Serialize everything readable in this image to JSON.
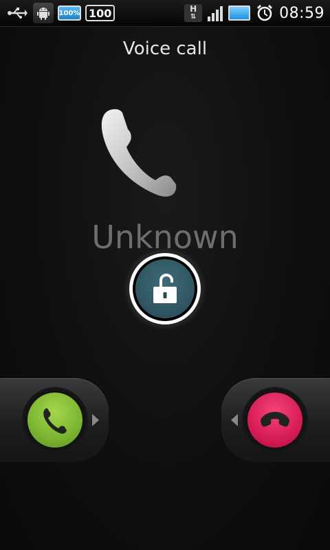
{
  "status_bar": {
    "icons": [
      "usb-icon",
      "android-icon",
      "battery-percent-icon",
      "battery-level-icon",
      "hsdpa-icon",
      "signal-icon",
      "battery-icon",
      "alarm-icon"
    ],
    "battery_small_text": "100%",
    "battery_number": "100",
    "network_type": "H",
    "time": "08:59"
  },
  "call": {
    "title": "Voice call",
    "caller_name": "Unknown"
  },
  "controls": {
    "answer_icon": "phone-answer-icon",
    "decline_icon": "phone-hangup-icon",
    "unlock_icon": "unlock-icon"
  },
  "colors": {
    "answer": "#7ab531",
    "decline": "#d71c56",
    "unlock": "#3e6a78"
  }
}
